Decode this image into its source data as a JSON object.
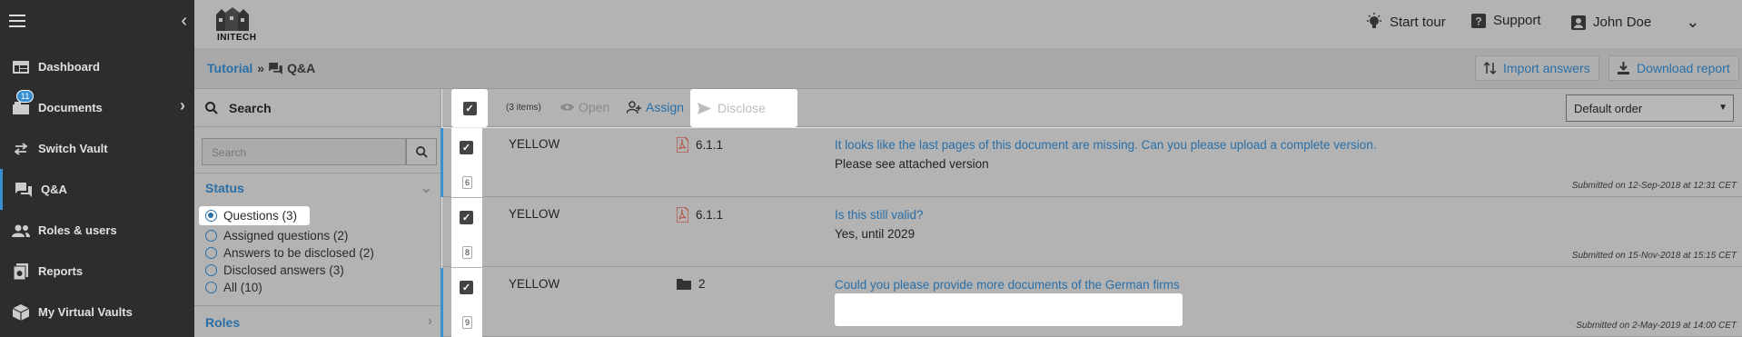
{
  "sidebar": {
    "items": [
      {
        "label": "Dashboard",
        "icon": "dashboard-icon"
      },
      {
        "label": "Documents",
        "icon": "documents-icon",
        "badge": "11"
      },
      {
        "label": "Switch Vault",
        "icon": "switch-icon"
      },
      {
        "label": "Q&A",
        "icon": "qa-icon"
      },
      {
        "label": "Roles & users",
        "icon": "users-icon"
      },
      {
        "label": "Reports",
        "icon": "reports-icon"
      },
      {
        "label": "My Virtual Vaults",
        "icon": "vault-icon"
      }
    ]
  },
  "header": {
    "logo_text": "INITECH",
    "start_tour": "Start tour",
    "support": "Support",
    "user": "John Doe"
  },
  "breadcrumb": {
    "parent": "Tutorial",
    "separator": "»",
    "current": "Q&A"
  },
  "actions": {
    "import": "Import answers",
    "download": "Download report"
  },
  "filter": {
    "search_title": "Search",
    "search_placeholder": "Search",
    "status_title": "Status",
    "options": [
      "Questions (3)",
      "Assigned questions (2)",
      "Answers to be disclosed (2)",
      "Disclosed answers (3)",
      "All (10)"
    ],
    "roles_title": "Roles"
  },
  "toolbar": {
    "count": "(3 items)",
    "open": "Open",
    "assign": "Assign",
    "disclose": "Disclose",
    "order": "Default order"
  },
  "rows": [
    {
      "num": "6",
      "category": "YELLOW",
      "ref": "6.1.1",
      "ref_icon": "pdf-icon",
      "question": "It looks like the last pages of this document are missing. Can you please upload a complete version.",
      "answer": "Please see attached version",
      "submitted": "Submitted on 12-Sep-2018 at 12:31 CET"
    },
    {
      "num": "8",
      "category": "YELLOW",
      "ref": "6.1.1",
      "ref_icon": "pdf-icon",
      "question": "Is this still valid?",
      "answer": "Yes, until 2029",
      "submitted": "Submitted on 15-Nov-2018 at 15:15 CET"
    },
    {
      "num": "9",
      "category": "YELLOW",
      "ref": "2",
      "ref_icon": "folder-icon",
      "question": "Could you please provide more documents of the German firms",
      "answer": "",
      "submitted": "Submitted on 2-May-2019 at 14:00 CET"
    }
  ],
  "colors": {
    "sidebar_bg": "#2d2d2d",
    "accent": "#3a8fd1",
    "link": "#2a6fa8",
    "overlay_gray": "#b3b3b3"
  }
}
